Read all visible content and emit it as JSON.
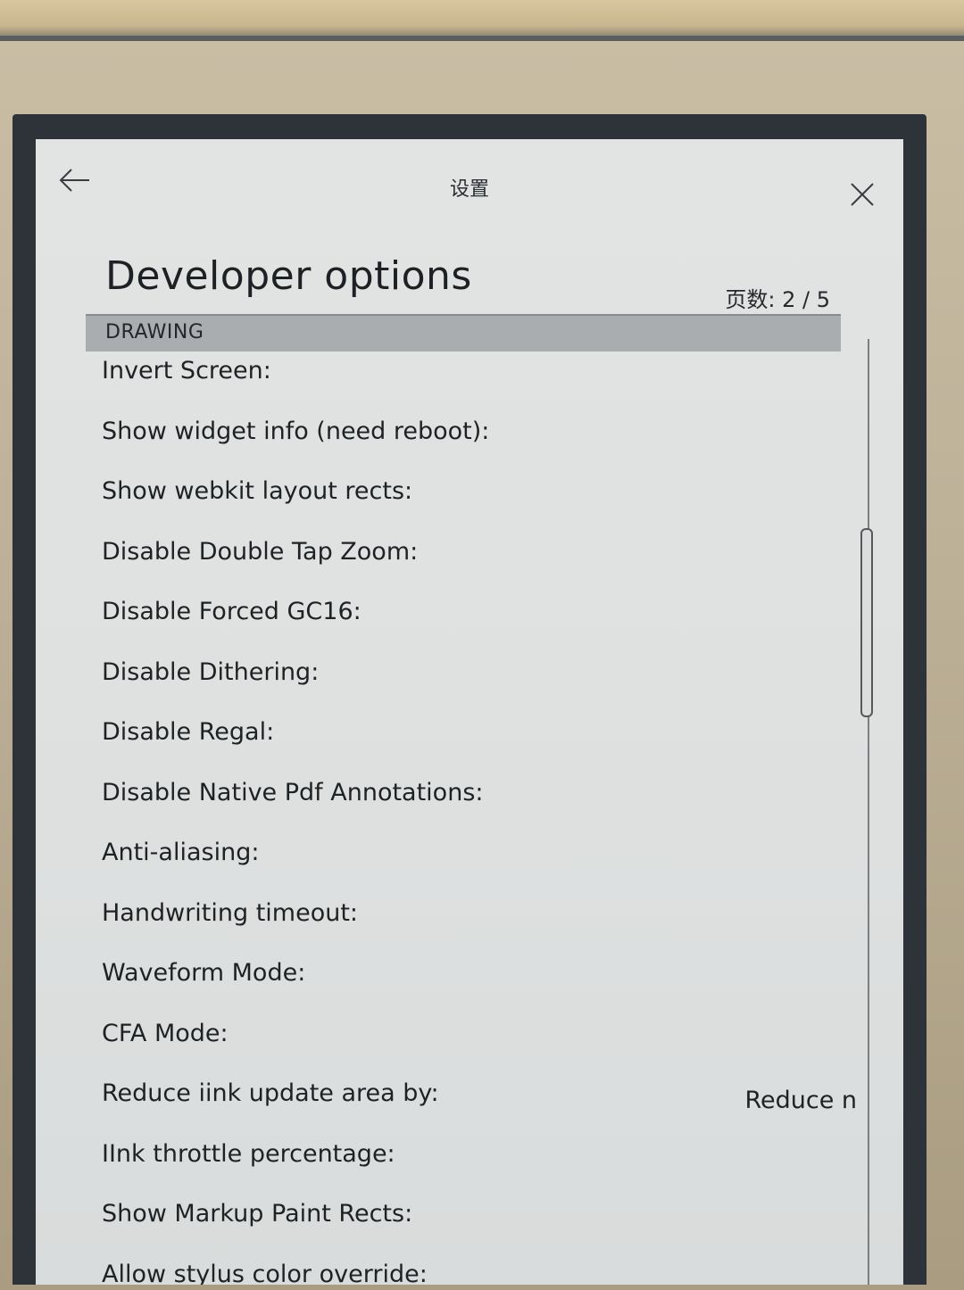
{
  "header": {
    "title": "设置",
    "back_icon": "arrow-left-icon",
    "close_icon": "close-icon"
  },
  "page": {
    "title": "Developer options",
    "page_count": "页数: 2 / 5"
  },
  "section": {
    "label": "DRAWING"
  },
  "options": [
    {
      "label": "Invert Screen:",
      "value": ""
    },
    {
      "label": "Show widget info (need reboot):",
      "value": ""
    },
    {
      "label": "Show webkit layout rects:",
      "value": ""
    },
    {
      "label": "Disable Double Tap Zoom:",
      "value": ""
    },
    {
      "label": "Disable Forced GC16:",
      "value": ""
    },
    {
      "label": "Disable Dithering:",
      "value": ""
    },
    {
      "label": "Disable Regal:",
      "value": ""
    },
    {
      "label": "Disable Native Pdf Annotations:",
      "value": ""
    },
    {
      "label": "Anti-aliasing:",
      "value": ""
    },
    {
      "label": "Handwriting timeout:",
      "value": ""
    },
    {
      "label": "Waveform Mode:",
      "value": ""
    },
    {
      "label": "CFA Mode:",
      "value": ""
    },
    {
      "label": "Reduce iink update area by:",
      "value": "Reduce n"
    },
    {
      "label": "IInk throttle percentage:",
      "value": ""
    },
    {
      "label": "Show Markup Paint Rects:",
      "value": ""
    },
    {
      "label": "Allow stylus color override:",
      "value": ""
    }
  ],
  "colors": {
    "screen_bg": "#e0e2e2",
    "section_bar": "#a9adb0",
    "text": "#1f2225",
    "bezel": "#2d3338"
  }
}
